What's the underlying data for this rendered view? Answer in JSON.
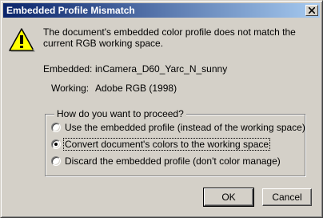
{
  "dialog": {
    "title": "Embedded Profile Mismatch",
    "message": "The document's embedded color profile does not match the current RGB working space.",
    "embedded_label": "Embedded:",
    "embedded_value": "inCamera_D60_Yarc_N_sunny",
    "working_label": "Working:",
    "working_value": "Adobe RGB (1998)",
    "group_label": "How do you want to proceed?",
    "options": [
      {
        "label": "Use the embedded profile (instead of the working space)",
        "selected": false
      },
      {
        "label": "Convert document's colors to the working space",
        "selected": true
      },
      {
        "label": "Discard the embedded profile (don't color manage)",
        "selected": false
      }
    ],
    "ok_label": "OK",
    "cancel_label": "Cancel"
  },
  "icons": {
    "warning": "warning-icon",
    "close": "close-icon"
  }
}
